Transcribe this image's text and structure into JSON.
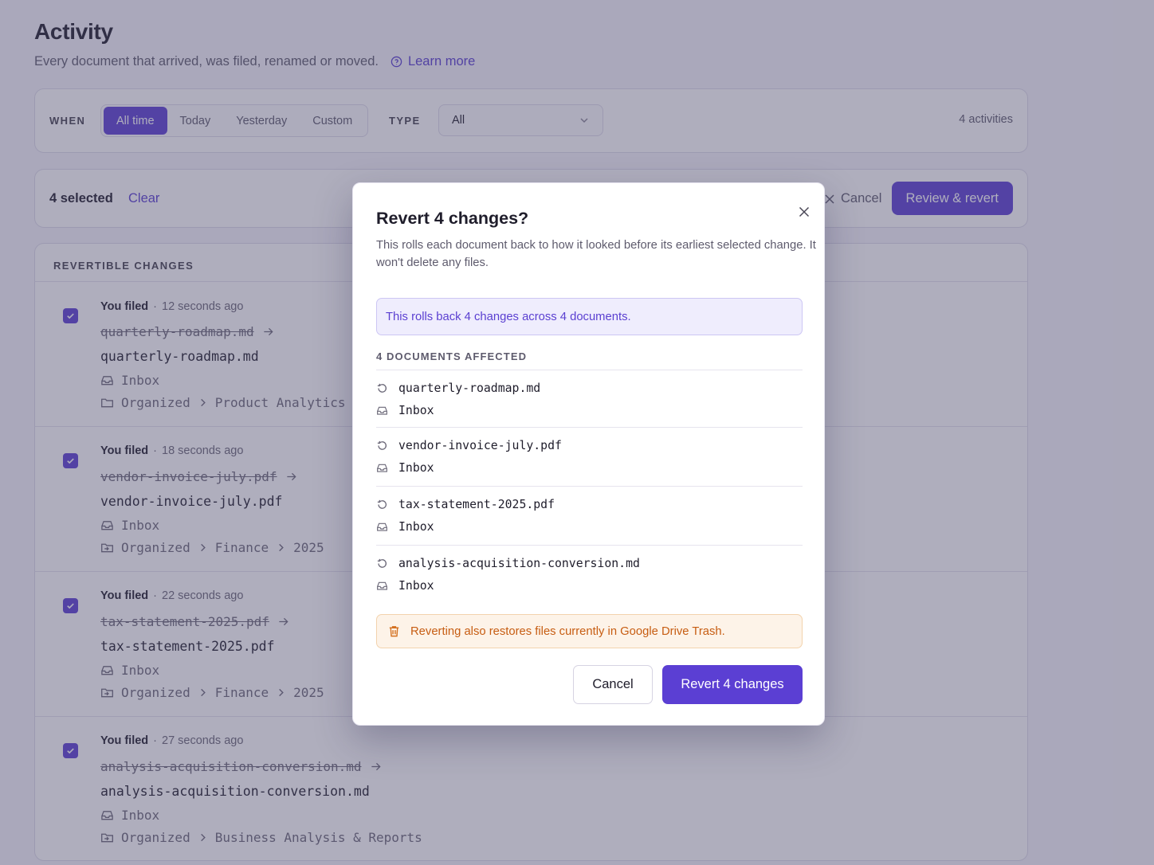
{
  "page": {
    "title": "Activity",
    "subtitle": "Every document that arrived, was filed, renamed or moved.",
    "learn_more": "Learn more"
  },
  "filters": {
    "when_label": "WHEN",
    "when_options": [
      "All time",
      "Today",
      "Yesterday",
      "Custom"
    ],
    "when_selected": "All time",
    "type_label": "TYPE",
    "type_value": "All",
    "count": "4 activities"
  },
  "selection": {
    "count": "4 selected",
    "clear": "Clear",
    "cancel": "Cancel",
    "review": "Review & revert"
  },
  "list": {
    "header": "REVERTIBLE CHANGES",
    "rows": [
      {
        "actor": "You filed",
        "time": "12 seconds ago",
        "old_name": "quarterly-roadmap.md",
        "new_name": "quarterly-roadmap.md",
        "from": "Inbox",
        "to_path": [
          "Organized",
          "Product Analytics &"
        ],
        "checked": true
      },
      {
        "actor": "You filed",
        "time": "18 seconds ago",
        "old_name": "vendor-invoice-july.pdf",
        "new_name": "vendor-invoice-july.pdf",
        "from": "Inbox",
        "to_path": [
          "Organized",
          "Finance",
          "2025"
        ],
        "checked": true
      },
      {
        "actor": "You filed",
        "time": "22 seconds ago",
        "old_name": "tax-statement-2025.pdf",
        "new_name": "tax-statement-2025.pdf",
        "from": "Inbox",
        "to_path": [
          "Organized",
          "Finance",
          "2025"
        ],
        "checked": true
      },
      {
        "actor": "You filed",
        "time": "27 seconds ago",
        "old_name": "analysis-acquisition-conversion.md",
        "new_name": "analysis-acquisition-conversion.md",
        "from": "Inbox",
        "to_path": [
          "Organized",
          "Business Analysis & Reports"
        ],
        "checked": true
      }
    ]
  },
  "modal": {
    "title": "Revert 4 changes?",
    "description": "This rolls each document back to how it looked before its earliest selected change. It won't delete any files.",
    "info": "This rolls back 4 changes across 4 documents.",
    "affected_label": "4 DOCUMENTS AFFECTED",
    "documents": [
      {
        "name": "quarterly-roadmap.md",
        "location": "Inbox"
      },
      {
        "name": "vendor-invoice-july.pdf",
        "location": "Inbox"
      },
      {
        "name": "tax-statement-2025.pdf",
        "location": "Inbox"
      },
      {
        "name": "analysis-acquisition-conversion.md",
        "location": "Inbox"
      }
    ],
    "warning": "Reverting also restores files currently in Google Drive Trash.",
    "cancel": "Cancel",
    "confirm": "Revert 4 changes"
  },
  "icons": {
    "learn_more": "help-circle-icon",
    "type_select": "chevron-down-icon",
    "close": "close-icon",
    "checkbox": "check-icon",
    "rename_arrow": "arrow-right-icon",
    "source": "inbox-icon",
    "destination": "folder-icon",
    "moved": "folder-move-icon",
    "revert": "undo-icon",
    "trash": "trash-icon"
  },
  "colors": {
    "accent": "#5b3fd3",
    "link": "#5a3fd1",
    "info_bg": "#efedfd",
    "warn_bg": "#fdf3e8",
    "warn_text": "#c75d12"
  }
}
